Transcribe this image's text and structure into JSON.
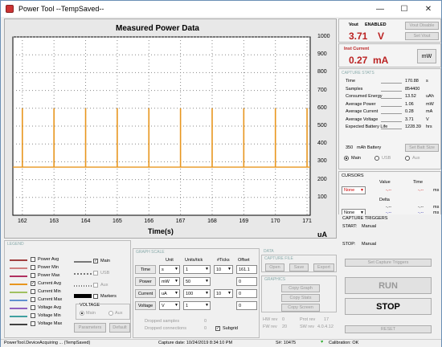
{
  "window": {
    "title": "Power Tool --TempSaved--",
    "minimize": "—",
    "maximize": "☐",
    "close": "✕"
  },
  "chart_data": {
    "type": "line",
    "title": "Measured Power Data",
    "xlabel": "Time(s)",
    "ylabel": "uA",
    "xlim": [
      161.7,
      171.1
    ],
    "ylim": [
      0,
      1000
    ],
    "x_ticks": [
      "162",
      "163",
      "164",
      "165",
      "166",
      "167",
      "168",
      "169",
      "170",
      "171"
    ],
    "y_ticks": [
      "100",
      "200",
      "300",
      "400",
      "500",
      "600",
      "700",
      "800",
      "900",
      "1000"
    ],
    "baseline": 270,
    "spike_peak": 600,
    "spikes_x": [
      162.0,
      163.0,
      164.0,
      165.0,
      166.0,
      167.0,
      168.0,
      169.0,
      170.0,
      171.0
    ],
    "series": [
      {
        "color": "#e8961e",
        "values": [
          270,
          600,
          270
        ]
      }
    ]
  },
  "vout": {
    "label": "Vout",
    "state": "ENABLED",
    "value": "3.71",
    "unit": "V",
    "btn1": "Vout Disable",
    "btn2": "Set Vout"
  },
  "inst": {
    "label": "Inst Current",
    "value": "0.27",
    "unit": "mA",
    "btn": "mW"
  },
  "capture_stats": {
    "title": "CAPTURE STATS",
    "rows": [
      {
        "k": "Time",
        "v": "170.88",
        "u": "s"
      },
      {
        "k": "Samples",
        "v": "854400",
        "u": ""
      },
      {
        "k": "Consumed Energy",
        "v": "13.52",
        "u": "uAh"
      },
      {
        "k": "Average Power",
        "v": "1.06",
        "u": "mW"
      },
      {
        "k": "Average Current",
        "v": "0.28",
        "u": "mA"
      },
      {
        "k": "Average Voltage",
        "v": "3.71",
        "u": "V"
      },
      {
        "k": "Expected Battery Life",
        "v": "1228.39",
        "u": "hrs"
      }
    ],
    "battery_val": "350",
    "battery_unit": "mAh Battery",
    "battery_btn": "Set Batt Size",
    "radios": [
      "Main",
      "USB",
      "Aux"
    ]
  },
  "cursors": {
    "title": "CURSORS",
    "value_hdr": "Value",
    "time_hdr": "Time",
    "sel1": "None",
    "sel2": "None",
    "dash": "-.--",
    "ms": "ms",
    "delta": "Delta"
  },
  "triggers": {
    "title": "CAPTURE TRIGGERS",
    "start_k": "START:",
    "start_v": "Manual",
    "stop_k": "STOP:",
    "stop_v": "Manual",
    "set_btn": "Set Capture Triggers"
  },
  "controls": {
    "run": "RUN",
    "stop": "STOP",
    "reset": "RESET"
  },
  "legend": {
    "title": "LEGEND",
    "items": [
      {
        "label": "Power Avg",
        "color": "#a04040",
        "checked": false
      },
      {
        "label": "Power Min",
        "color": "#d08080",
        "checked": false
      },
      {
        "label": "Power Max",
        "color": "#b03060",
        "checked": false
      },
      {
        "label": "Current Avg",
        "color": "#e8961e",
        "checked": true
      },
      {
        "label": "Current Min",
        "color": "#a0c060",
        "checked": false
      },
      {
        "label": "Current Max",
        "color": "#6090d0",
        "checked": false
      },
      {
        "label": "Voltage Avg",
        "color": "#9060c0",
        "checked": false
      },
      {
        "label": "Voltage Min",
        "color": "#40a0a0",
        "checked": false
      },
      {
        "label": "Voltage Max",
        "color": "#404040",
        "checked": false
      }
    ],
    "main": "Main",
    "usb": "USB",
    "aux": "Aux",
    "markers": "Markers",
    "voltage_title": "VOLTAGE",
    "v_main": "Main",
    "v_aux": "Aux",
    "params_btn": "Parameters",
    "default_btn": "Default"
  },
  "graph_scale": {
    "title": "GRAPH SCALE",
    "unit_hdr": "Unit",
    "upt_hdr": "Units/tick",
    "ticks_hdr": "#Ticks",
    "offset_hdr": "Offset",
    "rows": [
      {
        "name": "Time",
        "unit": "s",
        "upt": "1",
        "ticks": "10",
        "offset": "161.1"
      },
      {
        "name": "Power",
        "unit": "mW",
        "upt": "50",
        "ticks": "",
        "offset": "0"
      },
      {
        "name": "Current",
        "unit": "uA",
        "upt": "100",
        "ticks": "10",
        "offset": "0"
      },
      {
        "name": "Voltage",
        "unit": "V",
        "upt": "1",
        "ticks": "",
        "offset": "0"
      }
    ],
    "dropped_samples": "Dropped samples",
    "dropped_conn": "Dropped connections",
    "dropped_val": "0",
    "subgrid": "Subgrid"
  },
  "data": {
    "title": "DATA",
    "capture_file": "CAPTURE FILE",
    "open": "Open",
    "save": "Save",
    "export": "Export",
    "graphics": "GRAPHICS",
    "copy_graph": "Copy Graph",
    "copy_stats": "Copy Stats",
    "copy_screen": "Copy Screen",
    "hw_k": "HW rev",
    "hw_v": "0",
    "prot_k": "Prot rev",
    "prot_v": "17",
    "fw_k": "FW rev",
    "fw_v": "20",
    "sw_k": "SW rev",
    "sw_v": "4.0.4.12"
  },
  "status": {
    "left": "PowerTool.DeviceAcquiring ... (TempSaved)",
    "date": "Capture date: 10/24/2019 8:34:10 PM",
    "sn": "S#: 10475",
    "cal": "Calibration: OK"
  }
}
